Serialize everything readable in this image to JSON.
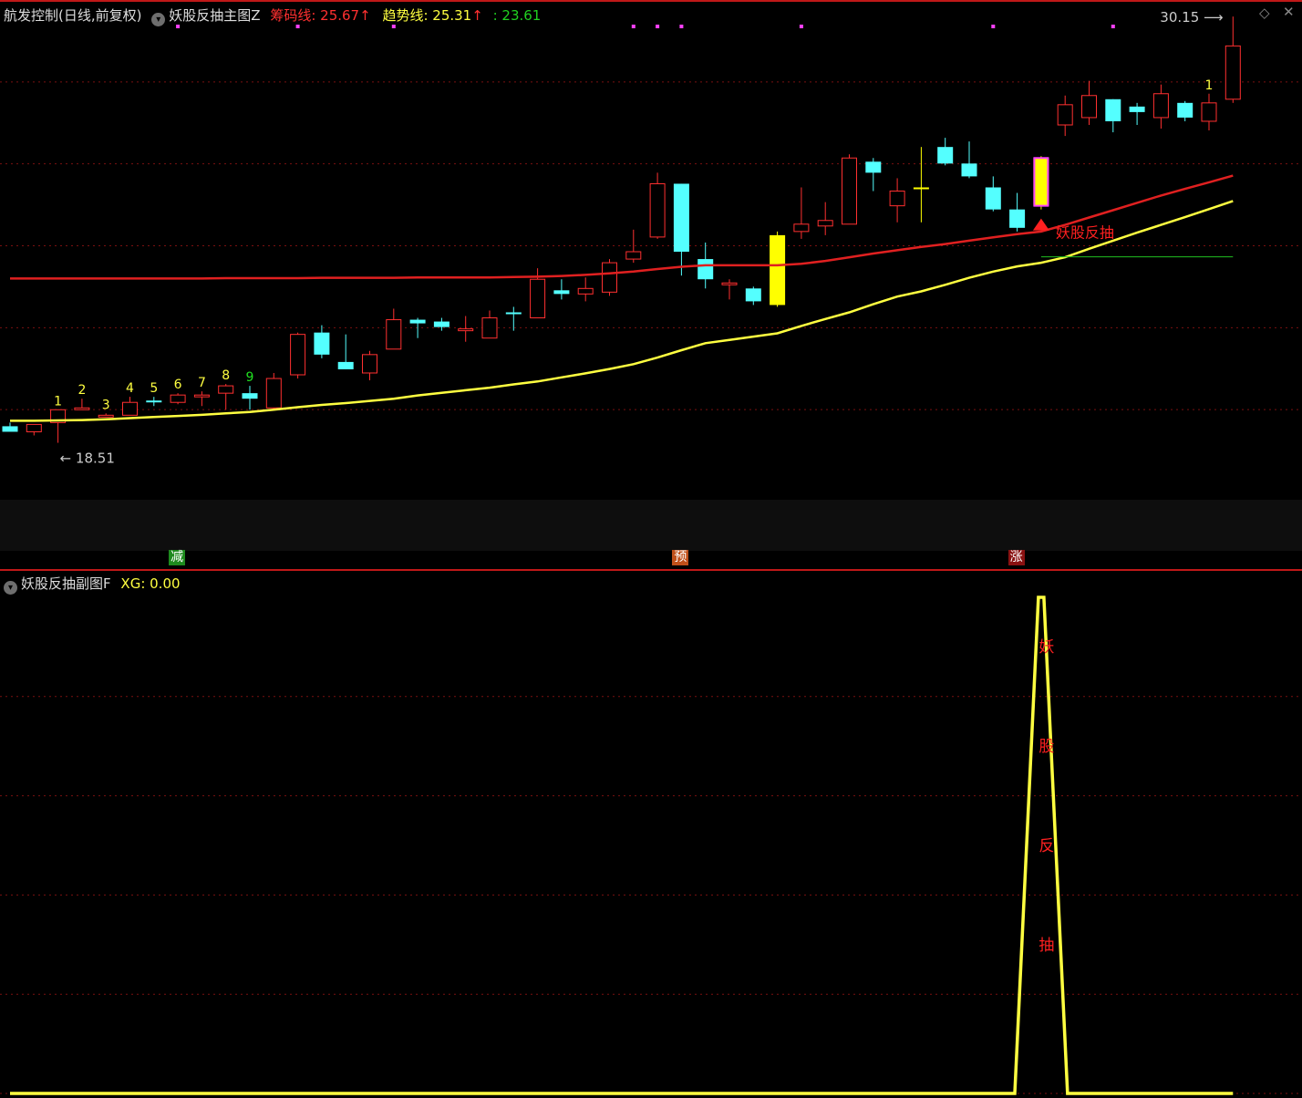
{
  "main_header": {
    "title": "航发控制(日线,前复权)",
    "formula": "妖股反抽主图Z",
    "chip_label": "筹码线: 25.67",
    "trend_label": "趋势线: 25.31",
    "extra_label": ": 23.61"
  },
  "sub_header": {
    "formula": "妖股反抽副图F",
    "xg_label": "XG: 0.00"
  },
  "price_labels": {
    "high": "30.15",
    "low": "18.51"
  },
  "signal_label": "妖股反抽",
  "bottom_tags": [
    {
      "text": "减",
      "bg": "#1e8a1e",
      "fg": "#ffffff"
    },
    {
      "text": "预",
      "bg": "#c0501a",
      "fg": "#ffffff"
    },
    {
      "text": "涨",
      "bg": "#8a1212",
      "fg": "#ffffff"
    }
  ],
  "peak_chars": [
    "妖",
    "股",
    "反",
    "抽"
  ],
  "colors": {
    "up": "#ff3030",
    "down": "#54ffff",
    "chip": "#e02020",
    "trend": "#ffff40",
    "grid": "#7a1010",
    "highlight": "#ffff00",
    "magenta": "#ff40ff",
    "signal": "#ff2020"
  },
  "chart_data": {
    "type": "candlestick",
    "y_range_main": [
      17.0,
      30.6
    ],
    "candles": [
      {
        "o": 19.0,
        "h": 19.1,
        "l": 18.9,
        "c": 18.85,
        "n": ""
      },
      {
        "o": 18.85,
        "h": 19.05,
        "l": 18.75,
        "c": 19.05,
        "n": ""
      },
      {
        "o": 19.1,
        "h": 19.45,
        "l": 18.55,
        "c": 19.45,
        "n": "1"
      },
      {
        "o": 19.5,
        "h": 19.75,
        "l": 19.45,
        "c": 19.5,
        "n": "2"
      },
      {
        "o": 19.3,
        "h": 19.35,
        "l": 19.25,
        "c": 19.3,
        "n": "3"
      },
      {
        "o": 19.3,
        "h": 19.8,
        "l": 19.3,
        "c": 19.65,
        "n": "4"
      },
      {
        "o": 19.7,
        "h": 19.8,
        "l": 19.55,
        "c": 19.65,
        "n": "5"
      },
      {
        "o": 19.65,
        "h": 19.9,
        "l": 19.6,
        "c": 19.85,
        "n": "6"
      },
      {
        "o": 19.8,
        "h": 19.95,
        "l": 19.55,
        "c": 19.85,
        "n": "7"
      },
      {
        "o": 19.9,
        "h": 20.15,
        "l": 19.45,
        "c": 20.1,
        "n": "8"
      },
      {
        "o": 19.9,
        "h": 20.1,
        "l": 19.45,
        "c": 19.75,
        "n": "9"
      },
      {
        "o": 19.5,
        "h": 20.45,
        "l": 19.45,
        "c": 20.3,
        "n": ""
      },
      {
        "o": 20.4,
        "h": 21.55,
        "l": 20.3,
        "c": 21.5,
        "n": ""
      },
      {
        "o": 21.55,
        "h": 21.75,
        "l": 20.85,
        "c": 20.95,
        "n": ""
      },
      {
        "o": 20.75,
        "h": 21.5,
        "l": 20.55,
        "c": 20.55,
        "n": ""
      },
      {
        "o": 20.45,
        "h": 21.05,
        "l": 20.25,
        "c": 20.95,
        "n": ""
      },
      {
        "o": 21.1,
        "h": 22.2,
        "l": 21.1,
        "c": 21.9,
        "n": ""
      },
      {
        "o": 21.9,
        "h": 21.95,
        "l": 21.4,
        "c": 21.8,
        "n": ""
      },
      {
        "o": 21.85,
        "h": 21.95,
        "l": 21.6,
        "c": 21.7,
        "n": ""
      },
      {
        "o": 21.6,
        "h": 22.0,
        "l": 21.3,
        "c": 21.65,
        "n": ""
      },
      {
        "o": 21.4,
        "h": 22.15,
        "l": 21.4,
        "c": 21.95,
        "n": ""
      },
      {
        "o": 22.1,
        "h": 22.25,
        "l": 21.6,
        "c": 22.05,
        "n": ""
      },
      {
        "o": 21.95,
        "h": 23.3,
        "l": 21.95,
        "c": 23.0,
        "n": ""
      },
      {
        "o": 22.7,
        "h": 23.0,
        "l": 22.45,
        "c": 22.6,
        "n": ""
      },
      {
        "o": 22.6,
        "h": 23.05,
        "l": 22.4,
        "c": 22.75,
        "n": ""
      },
      {
        "o": 22.65,
        "h": 23.55,
        "l": 22.55,
        "c": 23.45,
        "n": ""
      },
      {
        "o": 23.55,
        "h": 24.35,
        "l": 23.45,
        "c": 23.75,
        "n": ""
      },
      {
        "o": 24.15,
        "h": 25.9,
        "l": 24.1,
        "c": 25.6,
        "n": ""
      },
      {
        "o": 25.6,
        "h": 25.6,
        "l": 23.1,
        "c": 23.75,
        "n": ""
      },
      {
        "o": 23.55,
        "h": 24.0,
        "l": 22.75,
        "c": 23.0,
        "n": ""
      },
      {
        "o": 22.9,
        "h": 23.0,
        "l": 22.45,
        "c": 22.9,
        "n": ""
      },
      {
        "o": 22.75,
        "h": 22.8,
        "l": 22.3,
        "c": 22.4,
        "n": ""
      },
      {
        "o": 22.3,
        "h": 24.3,
        "l": 22.25,
        "c": 24.2,
        "n": "",
        "hl": "yellow"
      },
      {
        "o": 24.3,
        "h": 25.5,
        "l": 24.1,
        "c": 24.5,
        "n": ""
      },
      {
        "o": 24.45,
        "h": 25.1,
        "l": 24.2,
        "c": 24.6,
        "n": ""
      },
      {
        "o": 24.5,
        "h": 26.4,
        "l": 24.5,
        "c": 26.3,
        "n": ""
      },
      {
        "o": 26.2,
        "h": 26.3,
        "l": 25.4,
        "c": 25.9,
        "n": ""
      },
      {
        "o": 25.0,
        "h": 25.75,
        "l": 24.55,
        "c": 25.4,
        "n": ""
      },
      {
        "o": 25.5,
        "h": 26.6,
        "l": 24.55,
        "c": 25.5,
        "n": "",
        "hl": "yellow"
      },
      {
        "o": 26.6,
        "h": 26.85,
        "l": 26.1,
        "c": 26.15,
        "n": ""
      },
      {
        "o": 26.15,
        "h": 26.75,
        "l": 25.75,
        "c": 25.8,
        "n": ""
      },
      {
        "o": 25.5,
        "h": 25.8,
        "l": 24.85,
        "c": 24.9,
        "n": ""
      },
      {
        "o": 24.9,
        "h": 25.35,
        "l": 24.3,
        "c": 24.4,
        "n": ""
      },
      {
        "o": 25.0,
        "h": 26.35,
        "l": 24.9,
        "c": 26.3,
        "n": "",
        "hl": "yellow-magenta"
      },
      {
        "o": 27.2,
        "h": 28.0,
        "l": 26.9,
        "c": 27.75,
        "n": ""
      },
      {
        "o": 27.4,
        "h": 28.4,
        "l": 27.2,
        "c": 28.0,
        "n": ""
      },
      {
        "o": 27.9,
        "h": 27.9,
        "l": 27.0,
        "c": 27.3,
        "n": ""
      },
      {
        "o": 27.7,
        "h": 27.8,
        "l": 27.2,
        "c": 27.55,
        "n": ""
      },
      {
        "o": 27.4,
        "h": 28.3,
        "l": 27.1,
        "c": 28.05,
        "n": ""
      },
      {
        "o": 27.8,
        "h": 27.85,
        "l": 27.3,
        "c": 27.4,
        "n": ""
      },
      {
        "o": 27.3,
        "h": 28.05,
        "l": 27.05,
        "c": 27.8,
        "n": "1"
      },
      {
        "o": 27.9,
        "h": 30.15,
        "l": 27.8,
        "c": 29.35,
        "n": ""
      }
    ],
    "chip_line": [
      23.02,
      23.02,
      23.02,
      23.02,
      23.02,
      23.02,
      23.02,
      23.02,
      23.02,
      23.03,
      23.03,
      23.03,
      23.03,
      23.04,
      23.04,
      23.04,
      23.04,
      23.05,
      23.05,
      23.05,
      23.05,
      23.06,
      23.07,
      23.09,
      23.12,
      23.16,
      23.21,
      23.28,
      23.34,
      23.38,
      23.38,
      23.38,
      23.38,
      23.42,
      23.5,
      23.6,
      23.7,
      23.79,
      23.88,
      23.96,
      24.05,
      24.14,
      24.23,
      24.3,
      24.48,
      24.68,
      24.88,
      25.08,
      25.28,
      25.46,
      25.64,
      25.82
    ],
    "trend_line": [
      19.15,
      19.15,
      19.16,
      19.17,
      19.19,
      19.22,
      19.25,
      19.28,
      19.31,
      19.35,
      19.39,
      19.45,
      19.52,
      19.58,
      19.63,
      19.69,
      19.75,
      19.84,
      19.91,
      19.98,
      20.05,
      20.14,
      20.22,
      20.33,
      20.44,
      20.56,
      20.69,
      20.87,
      21.07,
      21.26,
      21.35,
      21.44,
      21.53,
      21.73,
      21.92,
      22.1,
      22.32,
      22.53,
      22.67,
      22.85,
      23.04,
      23.21,
      23.35,
      23.45,
      23.6,
      23.83,
      24.05,
      24.27,
      24.48,
      24.69,
      24.91,
      25.13
    ],
    "support_level": 23.61,
    "support_start_index": 43,
    "signal_index": 43,
    "sub_series": {
      "baseline": 0.0,
      "peak": 1.0,
      "peak_index": 43,
      "width_candles": 1.1
    },
    "top_markers_index": [
      7,
      12,
      16,
      26,
      27,
      28,
      33,
      41,
      46
    ],
    "tag_indices": [
      7,
      28,
      42
    ]
  }
}
